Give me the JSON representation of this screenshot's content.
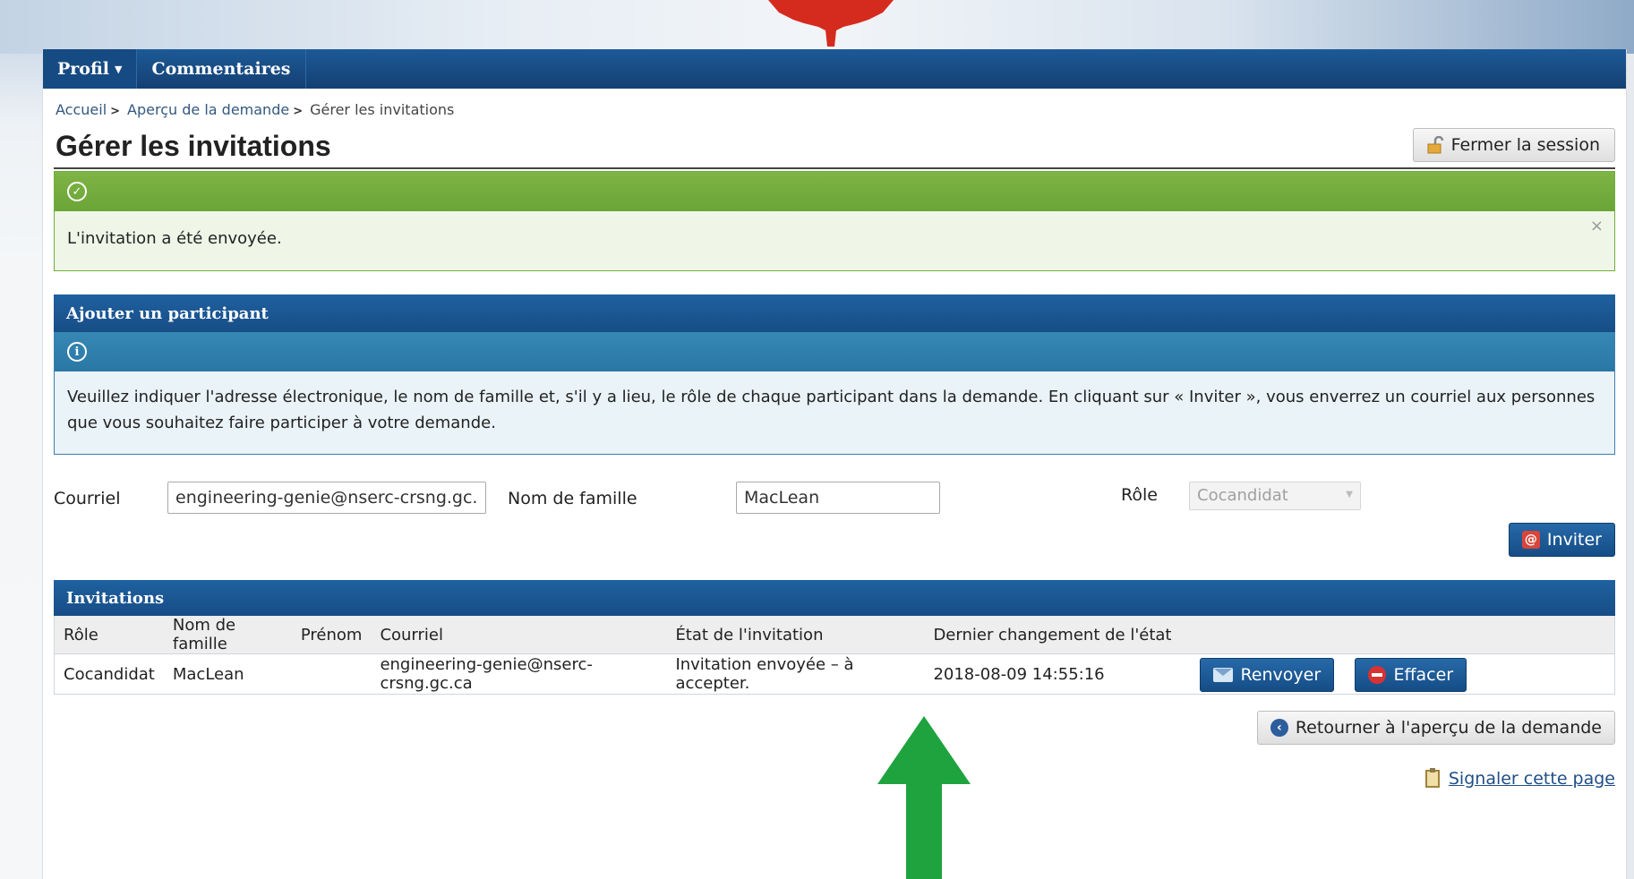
{
  "nav": {
    "profile_label": "Profil",
    "comments_label": "Commentaires"
  },
  "breadcrumb": {
    "home": "Accueil",
    "overview": "Aperçu de la demande",
    "current": "Gérer les invitations"
  },
  "page": {
    "title": "Gérer les invitations",
    "logout_label": "Fermer la session"
  },
  "alert": {
    "message": "L'invitation a été envoyée.",
    "close": "×"
  },
  "add_participant": {
    "heading": "Ajouter un participant",
    "info_text": "Veuillez indiquer l'adresse électronique, le nom de famille et, s'il y a lieu, le rôle de chaque participant dans la demande. En cliquant sur « Inviter », vous enverrez un courriel aux personnes que vous souhaitez faire participer à votre demande.",
    "email_label": "Courriel",
    "email_value": "engineering-genie@nserc-crsng.gc.ca",
    "lastname_label": "Nom de famille",
    "lastname_value": "MacLean",
    "role_label": "Rôle",
    "role_value": "Cocandidat",
    "invite_label": "Inviter"
  },
  "invitations": {
    "heading": "Invitations",
    "columns": [
      "Rôle",
      "Nom de famille",
      "Prénom",
      "Courriel",
      "État de l'invitation",
      "Dernier changement de l'état"
    ],
    "rows": [
      {
        "role": "Cocandidat",
        "lastname": "MacLean",
        "firstname": "",
        "email": "engineering-genie@nserc-crsng.gc.ca",
        "status": "Invitation envoyée – à accepter.",
        "changed": "2018-08-09 14:55:16",
        "resend_label": "Renvoyer",
        "delete_label": "Effacer"
      }
    ]
  },
  "footer": {
    "back_label": "Retourner à l'aperçu de la demande",
    "report_label": "Signaler cette page"
  },
  "colors": {
    "nav_blue": "#143f72",
    "success_green": "#7fb446",
    "info_blue": "#2a77a4",
    "annotation_arrow": "#1fa33f"
  }
}
